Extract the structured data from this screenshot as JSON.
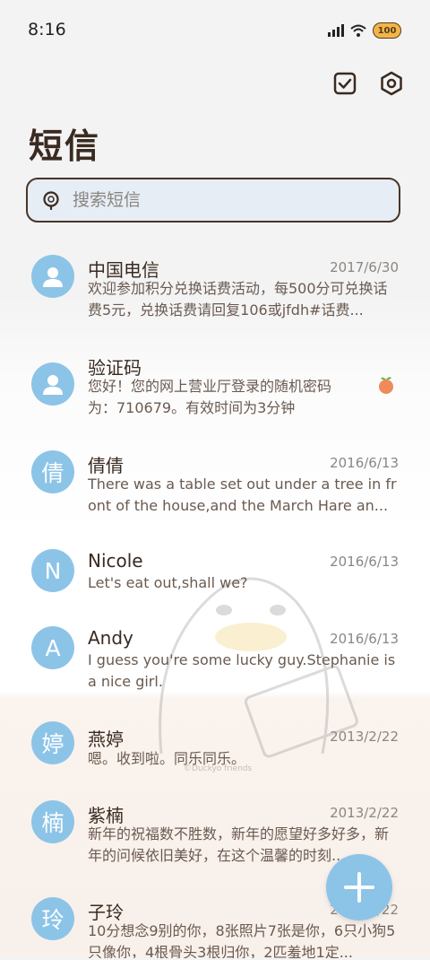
{
  "status": {
    "time": "8:16",
    "battery": "100"
  },
  "header": {
    "title": "短信"
  },
  "search": {
    "placeholder": "搜索短信"
  },
  "messages": [
    {
      "avatar": "",
      "name": "中国电信",
      "date": "2017/6/30",
      "snippet": "欢迎参加积分兑换话费活动，每500分可兑换话费5元，兑换话费请回复106或jfdh#话费..."
    },
    {
      "avatar": "",
      "name": "验证码",
      "date": "",
      "snippet": "您好！您的网上营业厅登录的随机密码为：710679。有效时间为3分钟"
    },
    {
      "avatar": "倩",
      "name": "倩倩",
      "date": "2016/6/13",
      "snippet": "There was a table set out under a tree in front of the house,and the March Hare an..."
    },
    {
      "avatar": "N",
      "name": "Nicole",
      "date": "2016/6/13",
      "snippet": "Let's eat out,shall we?"
    },
    {
      "avatar": "A",
      "name": "Andy",
      "date": "2016/6/13",
      "snippet": "I guess you're some lucky guy.Stephanie is a nice girl."
    },
    {
      "avatar": "婷",
      "name": "燕婷",
      "date": "2013/2/22",
      "snippet": "嗯。收到啦。同乐同乐。"
    },
    {
      "avatar": "楠",
      "name": "紫楠",
      "date": "2013/2/22",
      "snippet": "新年的祝福数不胜数，新年的愿望好多好多，新年的问候依旧美好，在这个温馨的时刻..."
    },
    {
      "avatar": "玲",
      "name": "子玲",
      "date": "2013/2/22",
      "snippet": "10分想念9别的你，8张照片7张是你，6只小狗5只像你，4根骨头3根归你，2匹羞地1定..."
    }
  ],
  "watermark": "©Duckyo friends",
  "colors": {
    "avatar": "#8cc4e8",
    "accent": "#8cc4e8",
    "text": "#3a2a20"
  }
}
